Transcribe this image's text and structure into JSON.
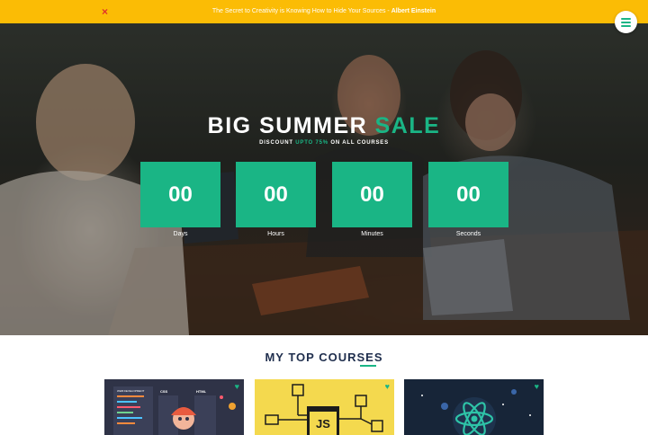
{
  "announcement": {
    "close_icon": "×",
    "quote_text": "The Secret to Creativity is Knowing How to Hide Your Sources -",
    "quote_author": "Albert Einstein"
  },
  "hero": {
    "title_main": "BIG SUMMER",
    "title_accent": "SALE",
    "subtitle_before": "DISCOUNT",
    "subtitle_accent": "UPTO 75%",
    "subtitle_after": "ON ALL COURSES"
  },
  "countdown": [
    {
      "value": "00",
      "label": "Days"
    },
    {
      "value": "00",
      "label": "Hours"
    },
    {
      "value": "00",
      "label": "Minutes"
    },
    {
      "value": "00",
      "label": "Seconds"
    }
  ],
  "courses_section": {
    "title": "MY TOP COURSES",
    "card_labels": {
      "web_label": "WEB DEVELOPMENT",
      "css_label": "CSS",
      "html_label": "HTML",
      "js_label": "JS"
    }
  },
  "colors": {
    "accent": "#1ab585",
    "banner": "#fbbc05",
    "heading": "#1f2e4d"
  }
}
